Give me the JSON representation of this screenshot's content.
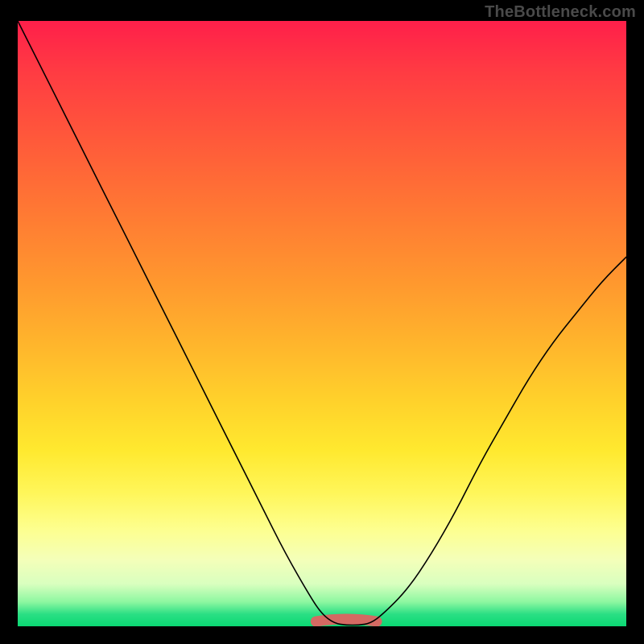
{
  "watermark": "TheBottleneck.com",
  "colors": {
    "frame": "#000000",
    "gradient_top": "#ff1f4a",
    "gradient_bottom": "#0bd873",
    "curve_stroke": "#000000",
    "bump_stroke": "#d46a63"
  },
  "chart_data": {
    "type": "line",
    "title": "",
    "xlabel": "",
    "ylabel": "",
    "xlim": [
      0,
      100
    ],
    "ylim": [
      0,
      100
    ],
    "series": [
      {
        "name": "bottleneck-curve",
        "x": [
          0,
          4,
          8,
          12,
          16,
          20,
          24,
          28,
          32,
          36,
          40,
          44,
          48,
          50,
          52,
          54,
          56,
          58,
          60,
          64,
          68,
          72,
          76,
          80,
          84,
          88,
          92,
          96,
          100
        ],
        "y": [
          100,
          92,
          84,
          76,
          68,
          60,
          52,
          44,
          36,
          28,
          20,
          12,
          5,
          2,
          0.5,
          0.2,
          0.2,
          0.5,
          2,
          6,
          12,
          19,
          27,
          34,
          41,
          47,
          52,
          57,
          61
        ]
      }
    ],
    "annotations": [
      {
        "name": "valley-bump",
        "x_start": 49,
        "x_end": 59,
        "y": 0.8
      }
    ]
  }
}
